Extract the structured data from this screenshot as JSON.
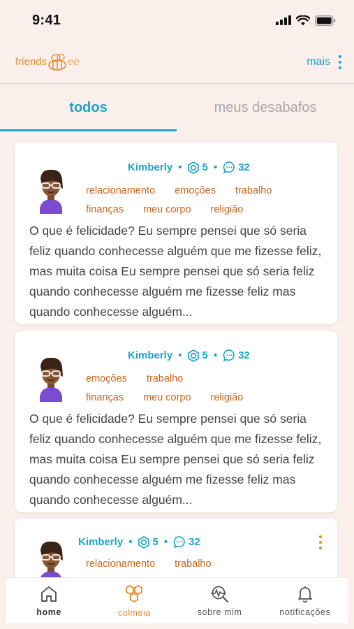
{
  "status_bar": {
    "time": "9:41"
  },
  "header": {
    "logo_text_main": "friends",
    "logo_text_suffix": "ee",
    "more_label": "mais"
  },
  "tabs": [
    {
      "label": "todos",
      "active": true
    },
    {
      "label": "meus desabafos",
      "active": false
    }
  ],
  "posts": [
    {
      "author": "Kimberly",
      "hive_count": "5",
      "comment_count": "32",
      "tags": [
        "relacionamento",
        "emoções",
        "trabalho",
        "finanças",
        "meu corpo",
        "religião"
      ],
      "text": "O que é felicidade? Eu sempre pensei que só seria feliz quando conhecesse alguém que me fizesse feliz, mas muita coisa Eu sempre pensei que só seria feliz quando conhecesse alguém me fizesse feliz mas quando conhecesse alguém..."
    },
    {
      "author": "Kimberly",
      "hive_count": "5",
      "comment_count": "32",
      "tags": [
        "emoções",
        "trabalho",
        "finanças",
        "meu corpo",
        "religião"
      ],
      "text": "O que é felicidade? Eu sempre pensei que só seria feliz quando conhecesse alguém que me fizesse feliz, mas muita coisa Eu sempre pensei que só seria feliz quando conhecesse alguém me fizesse feliz mas quando conhecesse alguém..."
    },
    {
      "author": "Kimberly",
      "hive_count": "5",
      "comment_count": "32",
      "tags": [
        "relacionamento",
        "trabalho"
      ],
      "text": ""
    }
  ],
  "bottom_nav": [
    {
      "label": "home",
      "icon": "home-icon"
    },
    {
      "label": "colmeia",
      "icon": "honeycomb-icon"
    },
    {
      "label": "sobre mim",
      "icon": "heartbeat-search-icon"
    },
    {
      "label": "notificações",
      "icon": "bell-icon"
    }
  ],
  "colors": {
    "accent_blue": "#1aa6c8",
    "accent_orange": "#e38a2a",
    "tag_orange": "#c9661e",
    "background": "#fbefec"
  }
}
